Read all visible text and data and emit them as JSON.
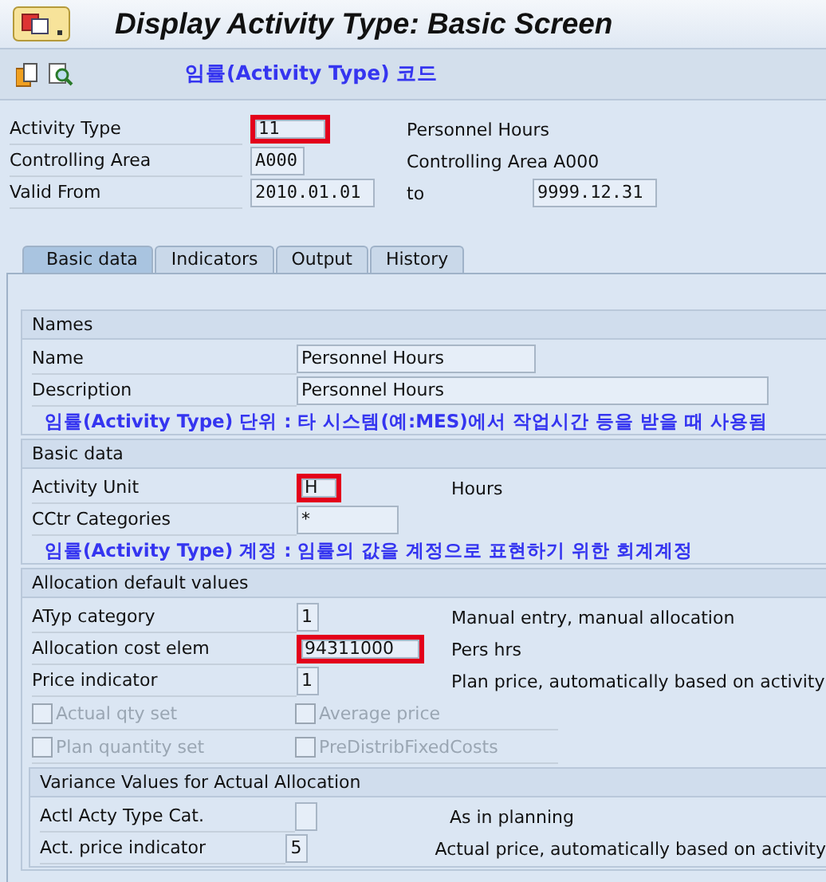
{
  "window": {
    "title": "Display Activity Type: Basic Screen"
  },
  "toolbar": {
    "note": "임률(Activity Type) 코드"
  },
  "header": {
    "rows": [
      {
        "label": "Activity Type",
        "value": "11",
        "highlighted": true,
        "description": "Personnel Hours"
      },
      {
        "label": "Controlling Area",
        "value": "A000",
        "highlighted": false,
        "description": "Controlling Area A000"
      },
      {
        "label": "Valid From",
        "value": "2010.01.01",
        "highlighted": false,
        "to_label": "to",
        "to_value": "9999.12.31"
      }
    ]
  },
  "tabs": [
    {
      "label": "Basic data",
      "selected": true
    },
    {
      "label": "Indicators",
      "selected": false
    },
    {
      "label": "Output",
      "selected": false
    },
    {
      "label": "History",
      "selected": false
    }
  ],
  "sections": [
    {
      "title": "Names",
      "rows": [
        {
          "kind": "field",
          "label": "Name",
          "value": "Personnel Hours",
          "highlighted": false
        },
        {
          "kind": "field",
          "label": "Description",
          "value": "Personnel Hours",
          "highlighted": false
        }
      ],
      "note": "임률(Activity Type) 단위 : 타 시스템(예:MES)에서 작업시간 등을 받을 때 사용됨"
    },
    {
      "title": "Basic data",
      "rows": [
        {
          "kind": "field",
          "label": "Activity Unit",
          "value": "H",
          "highlighted": true,
          "description": "Hours"
        },
        {
          "kind": "field",
          "label": "CCtr Categories",
          "value": "*",
          "highlighted": false
        }
      ],
      "note": "임률(Activity Type) 계정 : 임률의 값을 계정으로 표현하기 위한 회계계정"
    },
    {
      "title": "Allocation default values",
      "rows": [
        {
          "kind": "field",
          "label": "ATyp category",
          "value": "1",
          "highlighted": false,
          "description": "Manual entry, manual allocation"
        },
        {
          "kind": "field",
          "label": "Allocation cost elem",
          "value": "94311000",
          "highlighted": true,
          "description": "Pers hrs"
        },
        {
          "kind": "field",
          "label": "Price indicator",
          "value": "1",
          "highlighted": false,
          "description": "Plan price, automatically based on activity"
        },
        {
          "kind": "checkboxes",
          "items": [
            {
              "label": "Actual qty set",
              "checked": false,
              "disabled": true
            },
            {
              "label": "Average price",
              "checked": false,
              "disabled": true
            }
          ]
        },
        {
          "kind": "checkboxes",
          "items": [
            {
              "label": "Plan quantity set",
              "checked": false,
              "disabled": true
            },
            {
              "label": "PreDistribFixedCosts",
              "checked": false,
              "disabled": true
            }
          ]
        }
      ],
      "subsection": {
        "title": "Variance Values for Actual Allocation",
        "rows": [
          {
            "kind": "field",
            "label": "Actl Acty Type Cat.",
            "value": "",
            "highlighted": false,
            "description": "As in planning"
          },
          {
            "kind": "field",
            "label": "Act. price indicator",
            "value": "5",
            "highlighted": false,
            "description": "Actual price, automatically based on activity"
          }
        ]
      }
    }
  ]
}
